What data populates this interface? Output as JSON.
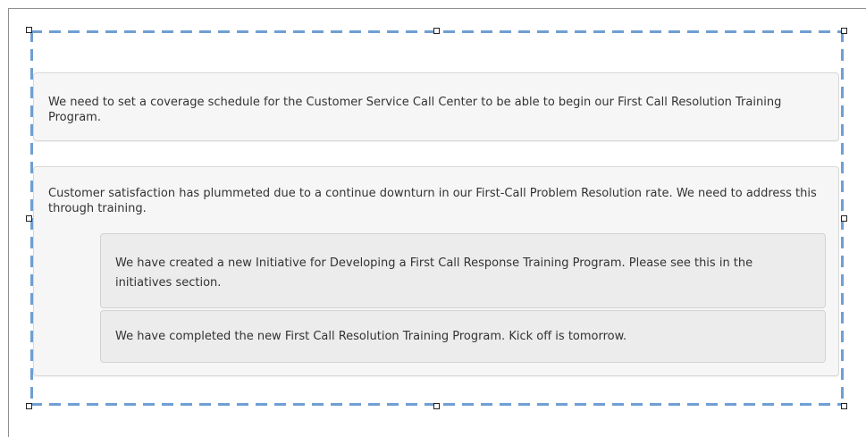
{
  "notes": [
    {
      "text": "We need to set a coverage schedule for the Customer Service Call Center to be able to begin our First Call Resolution Training Program.",
      "replies": []
    },
    {
      "text": "Customer satisfaction has plummeted due to a continue downturn in our First-Call Problem Resolution rate. We need to address this through training.",
      "replies": [
        {
          "text": "We have created a new Initiative for Developing a First Call Response Training Program. Please see this in the initiatives section."
        },
        {
          "text": "We have completed the new First Call Resolution Training Program. Kick off is tomorrow."
        }
      ]
    }
  ],
  "colors": {
    "selection_border": "#6f9fd3",
    "note_background": "#f6f6f6",
    "reply_background": "#ececec",
    "text": "#333333"
  }
}
